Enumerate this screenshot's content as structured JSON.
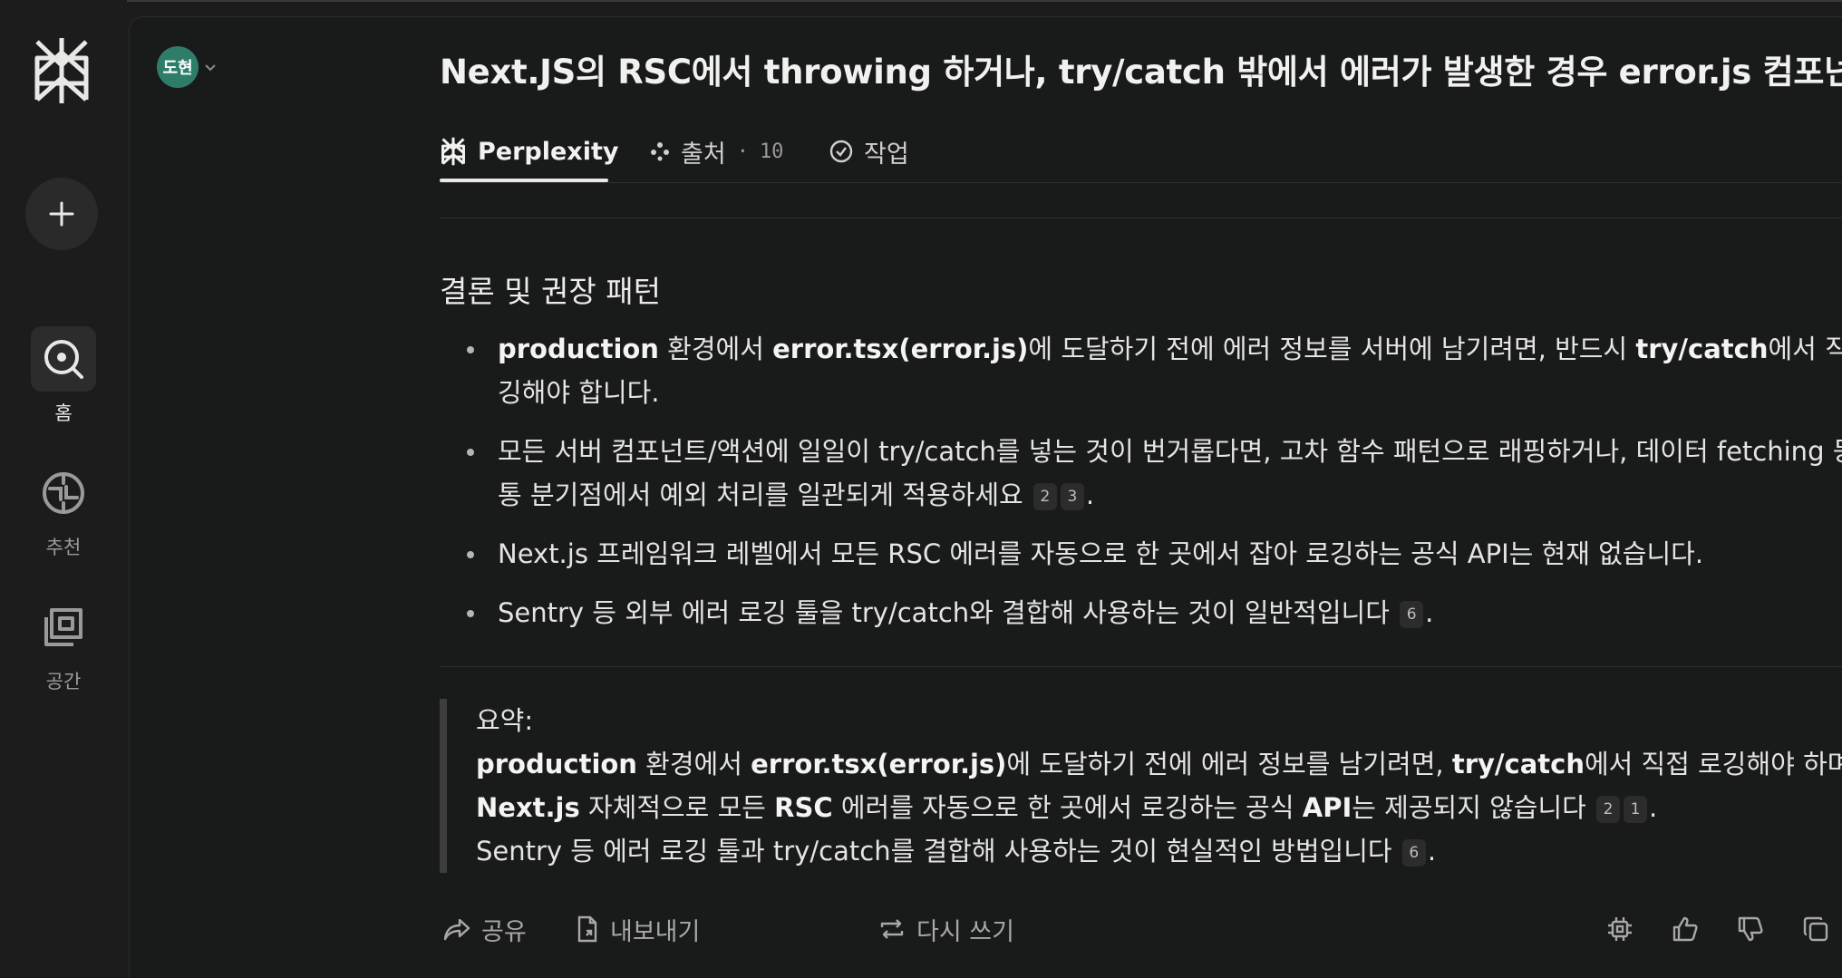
{
  "sidebar": {
    "items": [
      {
        "label": "홈",
        "icon": "search-icon"
      },
      {
        "label": "추천",
        "icon": "discover-icon"
      },
      {
        "label": "공간",
        "icon": "spaces-icon"
      }
    ]
  },
  "user": {
    "avatar_text": "도현"
  },
  "thread": {
    "title": "Next.JS의 RSC에서 throwing 하거나, try/catch 밖에서 에러가 발생한 경우 error.js 컴포넌트가..."
  },
  "tabs": {
    "answer": "Perplexity",
    "sources": "출처",
    "sources_sep": "·",
    "sources_count": "10",
    "tasks": "작업"
  },
  "answer": {
    "section_title": "결론 및 권장 패턴",
    "bullet1": {
      "b1": "production",
      "t1": " 환경에서 ",
      "b2": "error.tsx(error.js)",
      "t2": "에 도달하기 전에 에러 정보를 서버에 남기려면, 반드시 ",
      "b3": "try/catch",
      "t3": "에서 직접 로깅해야 합니다."
    },
    "bullet2": {
      "text": "모든 서버 컴포넌트/액션에 일일이 try/catch를 넣는 것이 번거롭다면, 고차 함수 패턴으로 래핑하거나, 데이터 fetching 등 공통 분기점에서 예외 처리를 일관되게 적용하세요",
      "cites": [
        "2",
        "3"
      ],
      "end": "."
    },
    "bullet3": {
      "text": "Next.js 프레임워크 레벨에서 모든 RSC 에러를 자동으로 한 곳에서 잡아 로깅하는 공식 API는 현재 없습니다."
    },
    "bullet4": {
      "text": "Sentry 등 외부 에러 로깅 툴을 try/catch와 결합해 사용하는 것이 일반적입니다",
      "cites": [
        "6"
      ],
      "end": "."
    },
    "summary": {
      "label": "요약:",
      "b1": "production",
      "t1": " 환경에서 ",
      "b2": "error.tsx(error.js)",
      "t2": "에 도달하기 전에 에러 정보를 남기려면, ",
      "b3": "try/catch",
      "t3": "에서 직접 로깅해야 하며, ",
      "b4": "Next.js",
      "t4": " 자체적으로 모든 ",
      "b5": "RSC",
      "t5": " 에러를 자동으로 한 곳에서 로깅하는 공식 ",
      "b6": "API",
      "t6": "는 제공되지 않습니다",
      "cites1": [
        "2",
        "1"
      ],
      "end1": ".",
      "line3": "Sentry 등 에러 로깅 툴과 try/catch를 결합해 사용하는 것이 현실적인 방법입니다",
      "cites2": [
        "6"
      ],
      "end2": "."
    }
  },
  "footer": {
    "share": "공유",
    "export": "내보내기",
    "rewrite": "다시 쓰기"
  },
  "colors": {
    "avatar": "#2e7d6b",
    "background": "#191a1a",
    "sidebar": "#1c1c1c"
  }
}
